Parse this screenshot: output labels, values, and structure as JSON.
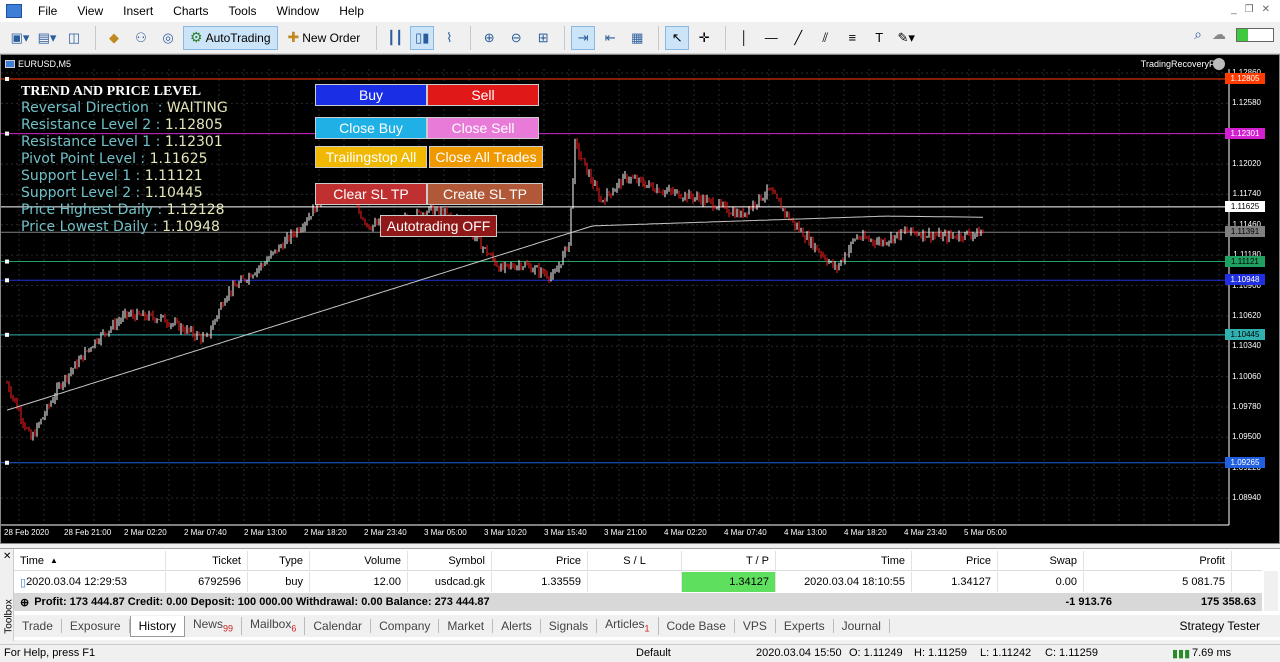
{
  "menu": [
    "File",
    "View",
    "Insert",
    "Charts",
    "Tools",
    "Window",
    "Help"
  ],
  "toolbar": {
    "autotrading": "AutoTrading",
    "new_order": "New Order"
  },
  "chart": {
    "window_title": "EURUSD,M5",
    "ea_name": "TradingRecoveryPro",
    "panel": {
      "heading": "TREND AND PRICE LEVEL",
      "lines": [
        {
          "label": "Reversal Direction  : ",
          "value": "WAITING"
        },
        {
          "label": "Resistance Level 2 : ",
          "value": "1.12805"
        },
        {
          "label": "Resistance Level 1 : ",
          "value": "1.12301"
        },
        {
          "label": "Pivot Point Level : ",
          "value": "1.11625"
        },
        {
          "label": "Support Level 1 : ",
          "value": "1.11121"
        },
        {
          "label": "Support Level 2 : ",
          "value": "1.10445"
        },
        {
          "label": "Price Highest Daily : ",
          "value": "1.12128"
        },
        {
          "label": "Price Lowest Daily : ",
          "value": "1.10948"
        }
      ]
    },
    "buttons": {
      "buy": "Buy",
      "sell": "Sell",
      "close_buy": "Close Buy",
      "close_sell": "Close Sell",
      "trailingstop_all": "Trailingstop All",
      "close_all": "Close All Trades",
      "clear_sltp": "Clear SL TP",
      "create_sltp": "Create SL TP",
      "autotrading_off": "Autotrading OFF"
    },
    "price_axis": [
      "1.12860",
      "1.12580",
      "1.12300",
      "1.12020",
      "1.11740",
      "1.11460",
      "1.11180",
      "1.10900",
      "1.10620",
      "1.10340",
      "1.10060",
      "1.09780",
      "1.09500",
      "1.09220",
      "1.08940"
    ],
    "levels": [
      {
        "name": "r2",
        "value": "1.12805",
        "color": "#ff3b00"
      },
      {
        "name": "r1",
        "value": "1.12301",
        "color": "#d020d0"
      },
      {
        "name": "pivot",
        "value": "1.11625",
        "color": "#ffffff"
      },
      {
        "name": "current",
        "value": "1.11391",
        "color": "#808080"
      },
      {
        "name": "s1",
        "value": "1.11121",
        "color": "#20a060"
      },
      {
        "name": "daily-low",
        "value": "1.10948",
        "color": "#2030e0"
      },
      {
        "name": "s2",
        "value": "1.10445",
        "color": "#30b0b0"
      },
      {
        "name": "bottom",
        "value": "1.09265",
        "color": "#2060e0"
      }
    ],
    "time_axis": [
      "28 Feb 2020",
      "28 Feb 21:00",
      "2 Mar 02:20",
      "2 Mar 07:40",
      "2 Mar 13:00",
      "2 Mar 18:20",
      "2 Mar 23:40",
      "3 Mar 05:00",
      "3 Mar 10:20",
      "3 Mar 15:40",
      "3 Mar 21:00",
      "4 Mar 02:20",
      "4 Mar 07:40",
      "4 Mar 13:00",
      "4 Mar 18:20",
      "4 Mar 23:40",
      "5 Mar 05:00"
    ],
    "colors": {
      "up_candle": "#ffffff",
      "down_candle": "#ff2020",
      "ma": "#c8c8c8"
    }
  },
  "terminal": {
    "columns": [
      "Time",
      "Ticket",
      "Type",
      "Volume",
      "Symbol",
      "Price",
      "S / L",
      "T / P",
      "Time",
      "Price",
      "Swap",
      "Profit"
    ],
    "row": [
      "2020.03.04 12:29:53",
      "6792596",
      "buy",
      "12.00",
      "usdcad.gk",
      "1.33559",
      "",
      "1.34127",
      "2020.03.04 18:10:55",
      "1.34127",
      "0.00",
      "5 081.75"
    ],
    "summary": "Profit: 173 444.87  Credit: 0.00  Deposit: 100 000.00  Withdrawal: 0.00  Balance: 273 444.87",
    "summary_swap": "-1 913.76",
    "summary_profit": "175 358.63",
    "side_label": "Toolbox",
    "tabs": [
      {
        "label": "Trade",
        "badge": ""
      },
      {
        "label": "Exposure",
        "badge": ""
      },
      {
        "label": "History",
        "badge": ""
      },
      {
        "label": "News",
        "badge": "99"
      },
      {
        "label": "Mailbox",
        "badge": "6"
      },
      {
        "label": "Calendar",
        "badge": ""
      },
      {
        "label": "Company",
        "badge": ""
      },
      {
        "label": "Market",
        "badge": ""
      },
      {
        "label": "Alerts",
        "badge": ""
      },
      {
        "label": "Signals",
        "badge": ""
      },
      {
        "label": "Articles",
        "badge": "1"
      },
      {
        "label": "Code Base",
        "badge": ""
      },
      {
        "label": "VPS",
        "badge": ""
      },
      {
        "label": "Experts",
        "badge": ""
      },
      {
        "label": "Journal",
        "badge": ""
      }
    ],
    "strategy_tester": "Strategy Tester"
  },
  "status": {
    "help": "For Help, press F1",
    "profile": "Default",
    "datetime": "2020.03.04 15:50",
    "open": "O: 1.11249",
    "high": "H: 1.11259",
    "low": "L: 1.11242",
    "close": "C: 1.11259",
    "ping": "7.69 ms"
  }
}
